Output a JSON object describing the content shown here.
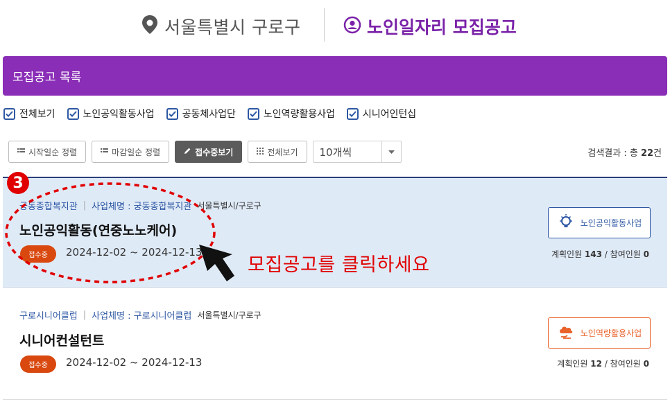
{
  "header": {
    "location": "서울특별시 구로구",
    "service_title": "노인일자리 모집공고"
  },
  "list_bar": {
    "title": "모집공고 목록"
  },
  "filters": [
    {
      "label": "전체보기",
      "checked": true
    },
    {
      "label": "노인공익활동사업",
      "checked": true
    },
    {
      "label": "공동체사업단",
      "checked": true
    },
    {
      "label": "노인역량활용사업",
      "checked": true
    },
    {
      "label": "시니어인턴십",
      "checked": true
    }
  ],
  "toolbar": {
    "sort_start": "시작일순 정렬",
    "sort_end": "마감일순 정렬",
    "open_only": "접수중보기",
    "view_all": "전체보기",
    "page_size": "10개씩"
  },
  "results": {
    "prefix": "검색결과 : 총 ",
    "count": "22",
    "suffix": "건"
  },
  "postings": [
    {
      "org": "궁동종합복지관",
      "biz_label": "사업체명 : 궁동종합복지관",
      "region": "서울특별시/구로구",
      "title": "노인공익활동(연중노노케어)",
      "status": "접수중",
      "period": "2024-12-02 ~ 2024-12-13",
      "type_tag": "노인공익활동사업",
      "planned_label": "계획인원 ",
      "planned": "143",
      "joined_label": " / 참여인원 ",
      "joined": "0"
    },
    {
      "org": "구로시니어클럽",
      "biz_label": "사업체명 : 구로시니어클럽",
      "region": "서울특별시/구로구",
      "title": "시니어컨설턴트",
      "status": "접수중",
      "period": "2024-12-02 ~ 2024-12-13",
      "type_tag": "노인역량활용사업",
      "planned_label": "계획인원 ",
      "planned": "12",
      "joined_label": " / 참여인원 ",
      "joined": "0"
    }
  ],
  "annotation": {
    "step": "3",
    "instruction": "모집공고를 클릭하세요"
  },
  "colors": {
    "brand_purple": "#8a2db7",
    "link_blue": "#2d57a3",
    "status_orange": "#d9480f",
    "highlight_bg": "#dfeaf7",
    "annotation_red": "#e00000"
  }
}
